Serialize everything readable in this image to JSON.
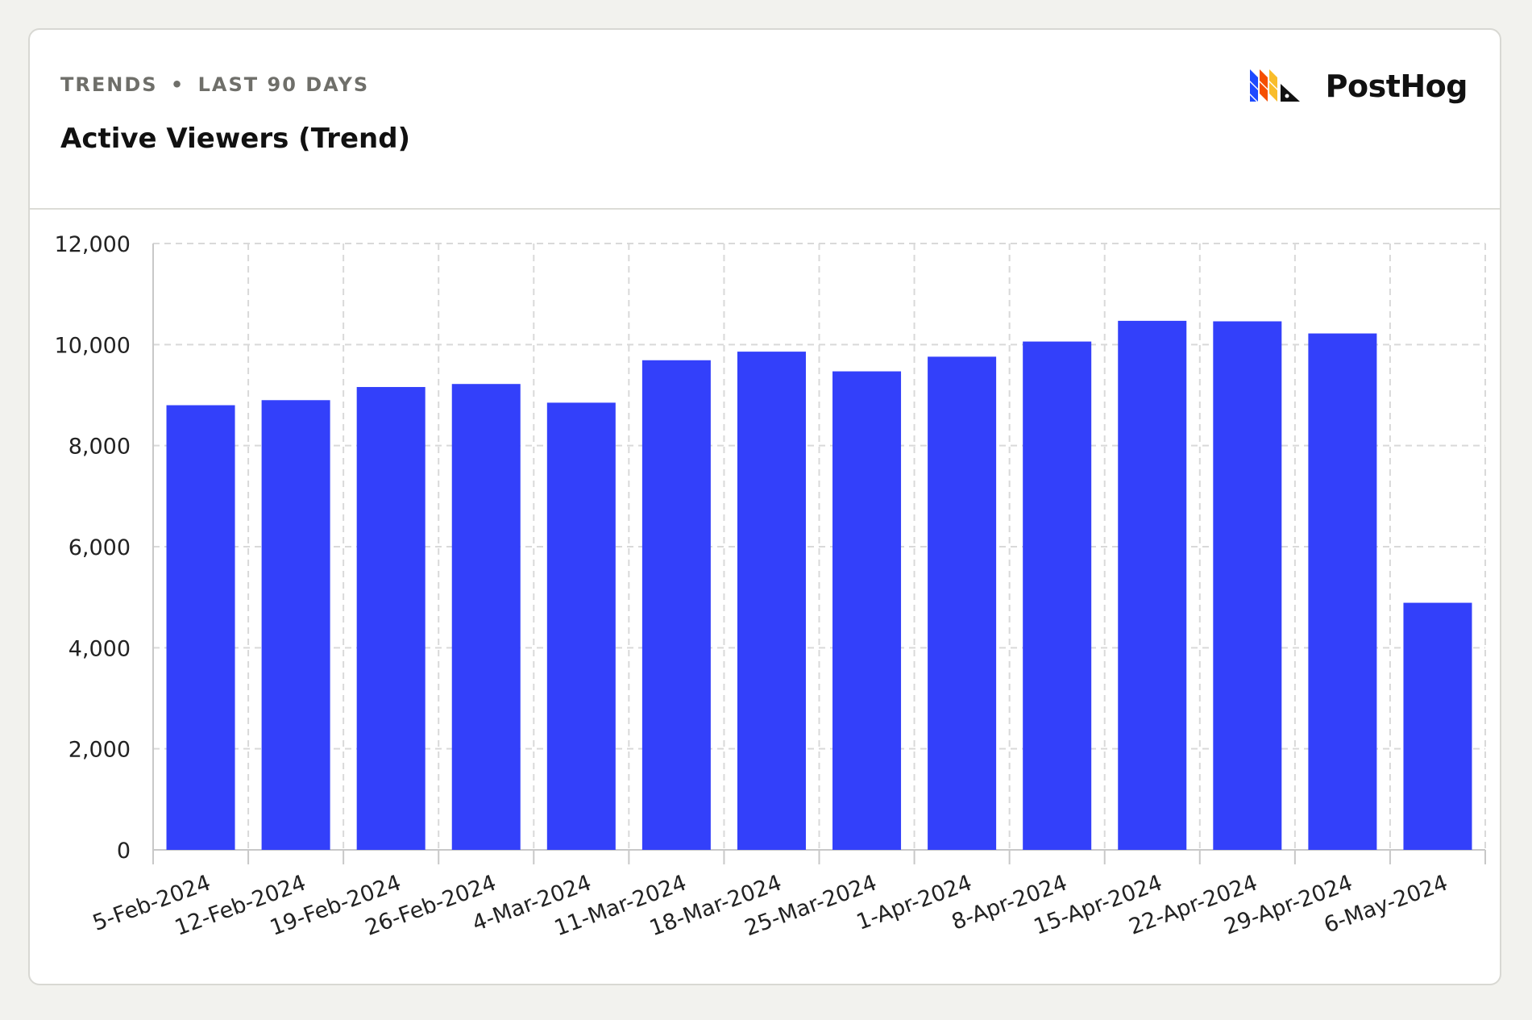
{
  "header": {
    "kicker_left": "TRENDS",
    "kicker_sep": "•",
    "kicker_right": "LAST 90 DAYS",
    "title": "Active Viewers (Trend)",
    "brand_name": "PostHog",
    "brand_icon": "posthog-logo-icon"
  },
  "colors": {
    "bar": "#3340fa",
    "grid": "#d9d9d9",
    "axis": "#c8c8c8",
    "text": "#222222"
  },
  "chart_data": {
    "type": "bar",
    "categories": [
      "5-Feb-2024",
      "12-Feb-2024",
      "19-Feb-2024",
      "26-Feb-2024",
      "4-Mar-2024",
      "11-Mar-2024",
      "18-Mar-2024",
      "25-Mar-2024",
      "1-Apr-2024",
      "8-Apr-2024",
      "15-Apr-2024",
      "22-Apr-2024",
      "29-Apr-2024",
      "6-May-2024"
    ],
    "values": [
      8800,
      8900,
      9160,
      9220,
      8850,
      9690,
      9860,
      9470,
      9760,
      10060,
      10470,
      10460,
      10220,
      4890
    ],
    "ylim": [
      0,
      12000
    ],
    "yticks": [
      0,
      2000,
      4000,
      6000,
      8000,
      10000,
      12000
    ],
    "ytick_labels": [
      "0",
      "2,000",
      "4,000",
      "6,000",
      "8,000",
      "10,000",
      "12,000"
    ],
    "grid": true,
    "legend": "none"
  }
}
